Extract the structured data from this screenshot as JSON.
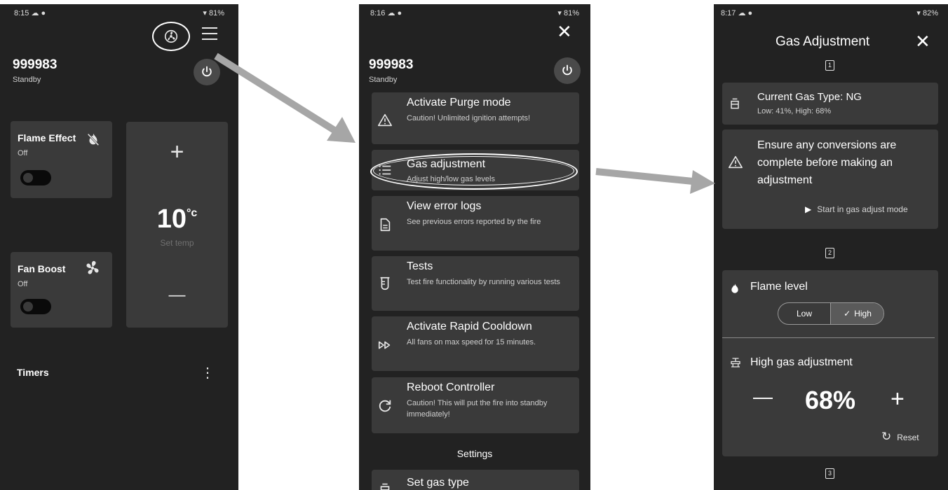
{
  "screen1": {
    "status": {
      "time": "8:15",
      "battery": "81%"
    },
    "device": {
      "name": "999983",
      "state": "Standby"
    },
    "flame_effect": {
      "title": "Flame Effect",
      "status": "Off"
    },
    "fan_boost": {
      "title": "Fan Boost",
      "status": "Off"
    },
    "temperature": {
      "plus": "+",
      "value": "10",
      "unit": "°c",
      "label": "Set temp",
      "minus": "—"
    },
    "timers": {
      "title": "Timers",
      "menu": "⋮"
    }
  },
  "screen2": {
    "status": {
      "time": "8:16",
      "battery": "81%"
    },
    "close": "✕",
    "device": {
      "name": "999983",
      "state": "Standby"
    },
    "menu": [
      {
        "title": "Activate Purge mode",
        "desc": "Caution! Unlimited ignition attempts!",
        "icon": "warning-icon"
      },
      {
        "title": "Gas adjustment",
        "desc": "Adjust high/low gas levels",
        "icon": "list-icon"
      },
      {
        "title": "View error logs",
        "desc": "See previous errors reported by the fire",
        "icon": "document-icon"
      },
      {
        "title": "Tests",
        "desc": "Test fire functionality by running various tests",
        "icon": "test-tube-icon"
      },
      {
        "title": "Activate Rapid Cooldown",
        "desc": "All fans on max speed for 15 minutes.",
        "icon": "fast-forward-icon"
      },
      {
        "title": "Reboot Controller",
        "desc": "Caution! This will put the fire into standby immediately!",
        "icon": "reload-icon"
      }
    ],
    "settings_heading": "Settings",
    "set_gas_type": "Set gas type"
  },
  "screen3": {
    "status": {
      "time": "8:17",
      "battery": "82%"
    },
    "title": "Gas Adjustment",
    "close": "✕",
    "steps": [
      "1",
      "2",
      "3"
    ],
    "gas_type": {
      "title": "Current Gas Type: NG",
      "sub": "Low: 41%, High: 68%"
    },
    "warning": {
      "text": "Ensure any conversions are complete before making an adjustment",
      "start_label": "Start in gas adjust mode"
    },
    "flame_level": {
      "title": "Flame level",
      "low": "Low",
      "high": "High",
      "selected": "High"
    },
    "high_gas": {
      "title": "High gas adjustment",
      "minus": "—",
      "value": "68%",
      "plus": "+",
      "reset": "Reset"
    }
  }
}
